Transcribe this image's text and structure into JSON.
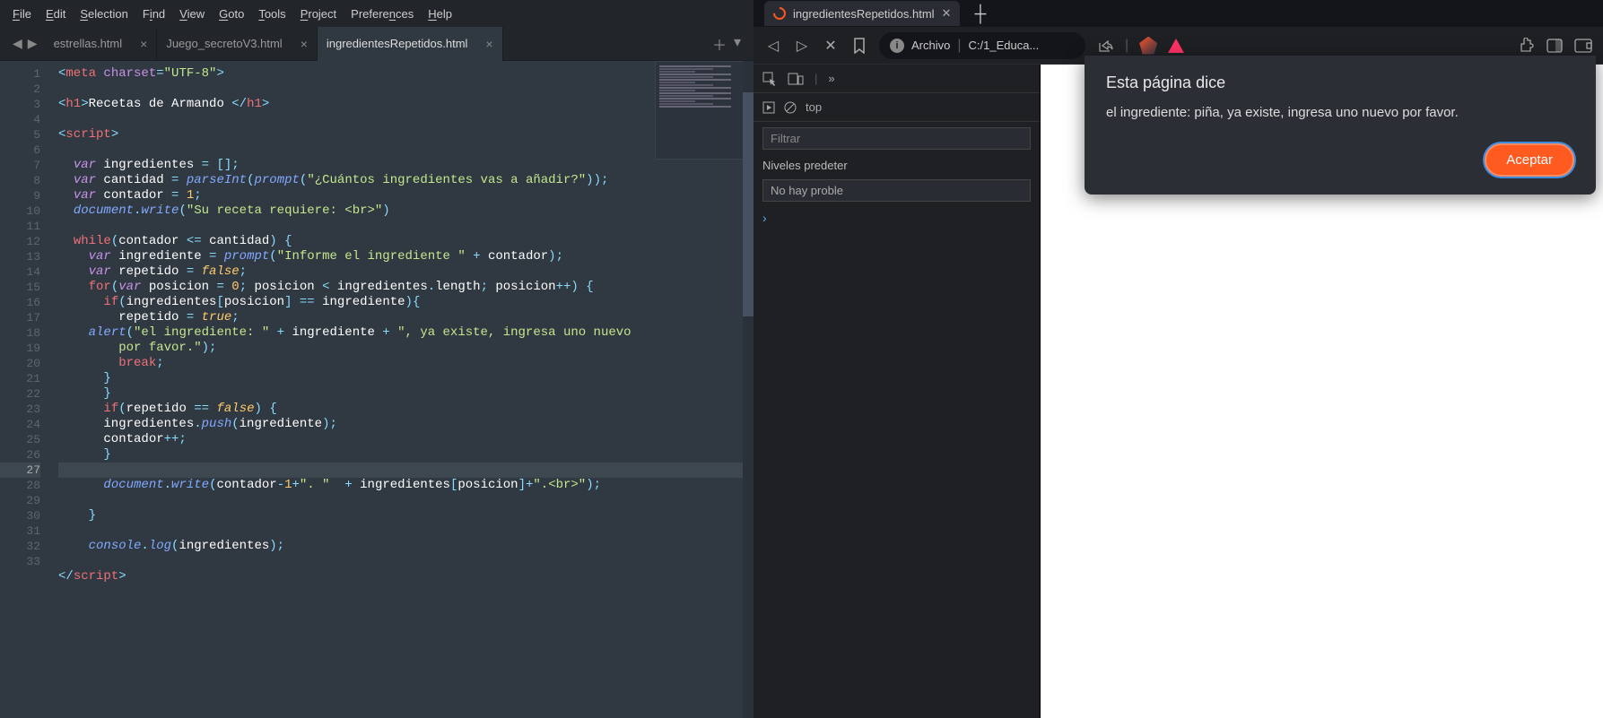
{
  "editor": {
    "menu": [
      "File",
      "Edit",
      "Selection",
      "Find",
      "View",
      "Goto",
      "Tools",
      "Project",
      "Preferences",
      "Help"
    ],
    "nav_prev": "◀",
    "nav_next": "▶",
    "tabs": [
      {
        "label": "estrellas.html",
        "active": false
      },
      {
        "label": "Juego_secretoV3.html",
        "active": false
      },
      {
        "label": "ingredientesRepetidos.html",
        "active": true
      }
    ],
    "line_numbers": [
      "1",
      "2",
      "3",
      "4",
      "5",
      "6",
      "7",
      "8",
      "9",
      "10",
      "11",
      "12",
      "13",
      "14",
      "15",
      "16",
      "17",
      "18",
      "19",
      "20",
      "21",
      "22",
      "23",
      "24",
      "25",
      "26",
      "27",
      "28",
      "29",
      "30",
      "31",
      "32",
      "33"
    ],
    "highlighted_line": 27,
    "code_tokens": [
      [
        [
          "op",
          "<"
        ],
        [
          "tag",
          "meta"
        ],
        [
          "ident",
          " "
        ],
        [
          "attr",
          "charset"
        ],
        [
          "op",
          "="
        ],
        [
          "str",
          "\"UTF-8\""
        ],
        [
          "op",
          ">"
        ]
      ],
      [],
      [
        [
          "op",
          "<"
        ],
        [
          "tag",
          "h1"
        ],
        [
          "op",
          ">"
        ],
        [
          "ident",
          "Recetas de Armando "
        ],
        [
          "op",
          "</"
        ],
        [
          "tag",
          "h1"
        ],
        [
          "op",
          ">"
        ]
      ],
      [],
      [
        [
          "op",
          "<"
        ],
        [
          "tag",
          "script"
        ],
        [
          "op",
          ">"
        ]
      ],
      [],
      [
        [
          "ident",
          "  "
        ],
        [
          "kw",
          "var"
        ],
        [
          "ident",
          " ingredientes "
        ],
        [
          "op",
          "="
        ],
        [
          "ident",
          " "
        ],
        [
          "op",
          "[]"
        ],
        [
          "op",
          ";"
        ]
      ],
      [
        [
          "ident",
          "  "
        ],
        [
          "kw",
          "var"
        ],
        [
          "ident",
          " cantidad "
        ],
        [
          "op",
          "="
        ],
        [
          "ident",
          " "
        ],
        [
          "fn",
          "parseInt"
        ],
        [
          "op",
          "("
        ],
        [
          "fn",
          "prompt"
        ],
        [
          "op",
          "("
        ],
        [
          "str",
          "\"¿Cuántos ingredientes vas a añadir?\""
        ],
        [
          "op",
          "));"
        ]
      ],
      [
        [
          "ident",
          "  "
        ],
        [
          "kw",
          "var"
        ],
        [
          "ident",
          " contador "
        ],
        [
          "op",
          "="
        ],
        [
          "ident",
          " "
        ],
        [
          "num",
          "1"
        ],
        [
          "op",
          ";"
        ]
      ],
      [
        [
          "ident",
          "  "
        ],
        [
          "obj",
          "document"
        ],
        [
          "op",
          "."
        ],
        [
          "fn",
          "write"
        ],
        [
          "op",
          "("
        ],
        [
          "str",
          "\"Su receta requiere: <br>\""
        ],
        [
          "op",
          ")"
        ]
      ],
      [],
      [
        [
          "ident",
          "  "
        ],
        [
          "kw2",
          "while"
        ],
        [
          "op",
          "("
        ],
        [
          "ident",
          "contador "
        ],
        [
          "op",
          "<="
        ],
        [
          "ident",
          " cantidad"
        ],
        [
          "op",
          ")"
        ],
        [
          "ident",
          " "
        ],
        [
          "op",
          "{"
        ]
      ],
      [
        [
          "ident",
          "    "
        ],
        [
          "kw",
          "var"
        ],
        [
          "ident",
          " ingrediente "
        ],
        [
          "op",
          "="
        ],
        [
          "ident",
          " "
        ],
        [
          "fn",
          "prompt"
        ],
        [
          "op",
          "("
        ],
        [
          "str",
          "\"Informe el ingrediente \""
        ],
        [
          "ident",
          " "
        ],
        [
          "op",
          "+"
        ],
        [
          "ident",
          " contador"
        ],
        [
          "op",
          ");"
        ]
      ],
      [
        [
          "ident",
          "    "
        ],
        [
          "kw",
          "var"
        ],
        [
          "ident",
          " repetido "
        ],
        [
          "op",
          "="
        ],
        [
          "ident",
          " "
        ],
        [
          "const",
          "false"
        ],
        [
          "op",
          ";"
        ]
      ],
      [
        [
          "ident",
          "    "
        ],
        [
          "kw2",
          "for"
        ],
        [
          "op",
          "("
        ],
        [
          "kw",
          "var"
        ],
        [
          "ident",
          " posicion "
        ],
        [
          "op",
          "="
        ],
        [
          "ident",
          " "
        ],
        [
          "num",
          "0"
        ],
        [
          "op",
          ";"
        ],
        [
          "ident",
          " posicion "
        ],
        [
          "op",
          "<"
        ],
        [
          "ident",
          " ingredientes"
        ],
        [
          "op",
          "."
        ],
        [
          "ident",
          "length"
        ],
        [
          "op",
          ";"
        ],
        [
          "ident",
          " posicion"
        ],
        [
          "op",
          "++)"
        ],
        [
          "ident",
          " "
        ],
        [
          "op",
          "{"
        ]
      ],
      [
        [
          "ident",
          "      "
        ],
        [
          "kw2",
          "if"
        ],
        [
          "op",
          "("
        ],
        [
          "ident",
          "ingredientes"
        ],
        [
          "op",
          "["
        ],
        [
          "ident",
          "posicion"
        ],
        [
          "op",
          "]"
        ],
        [
          "ident",
          " "
        ],
        [
          "op",
          "=="
        ],
        [
          "ident",
          " ingrediente"
        ],
        [
          "op",
          "){"
        ]
      ],
      [
        [
          "ident",
          "        repetido "
        ],
        [
          "op",
          "="
        ],
        [
          "ident",
          " "
        ],
        [
          "const",
          "true"
        ],
        [
          "op",
          ";"
        ]
      ],
      [
        [
          "ident",
          "    "
        ],
        [
          "fn",
          "alert"
        ],
        [
          "op",
          "("
        ],
        [
          "str",
          "\"el ingrediente: \""
        ],
        [
          "ident",
          " "
        ],
        [
          "op",
          "+"
        ],
        [
          "ident",
          " ingrediente "
        ],
        [
          "op",
          "+"
        ],
        [
          "ident",
          " "
        ],
        [
          "str",
          "\", ya existe, ingresa uno nuevo"
        ]
      ],
      [
        [
          "str",
          "        por favor.\""
        ],
        [
          "op",
          ");"
        ]
      ],
      [
        [
          "ident",
          "        "
        ],
        [
          "kw2",
          "break"
        ],
        [
          "op",
          ";"
        ]
      ],
      [
        [
          "ident",
          "      "
        ],
        [
          "op",
          "}"
        ]
      ],
      [
        [
          "ident",
          "      "
        ],
        [
          "op",
          "}"
        ]
      ],
      [
        [
          "ident",
          "      "
        ],
        [
          "kw2",
          "if"
        ],
        [
          "op",
          "("
        ],
        [
          "ident",
          "repetido "
        ],
        [
          "op",
          "=="
        ],
        [
          "ident",
          " "
        ],
        [
          "const",
          "false"
        ],
        [
          "op",
          ")"
        ],
        [
          "ident",
          " "
        ],
        [
          "op",
          "{"
        ]
      ],
      [
        [
          "ident",
          "      ingredientes"
        ],
        [
          "op",
          "."
        ],
        [
          "fn",
          "push"
        ],
        [
          "op",
          "("
        ],
        [
          "ident",
          "ingrediente"
        ],
        [
          "op",
          ");"
        ]
      ],
      [
        [
          "ident",
          "      contador"
        ],
        [
          "op",
          "++;"
        ]
      ],
      [
        [
          "ident",
          "      "
        ],
        [
          "op",
          "}"
        ]
      ],
      [],
      [
        [
          "ident",
          "      "
        ],
        [
          "obj",
          "document"
        ],
        [
          "op",
          "."
        ],
        [
          "fn",
          "write"
        ],
        [
          "op",
          "("
        ],
        [
          "ident",
          "contador"
        ],
        [
          "op",
          "-"
        ],
        [
          "num",
          "1"
        ],
        [
          "op",
          "+"
        ],
        [
          "str",
          "\". \""
        ],
        [
          "ident",
          "  "
        ],
        [
          "op",
          "+"
        ],
        [
          "ident",
          " ingredientes"
        ],
        [
          "op",
          "["
        ],
        [
          "ident",
          "posicion"
        ],
        [
          "op",
          "]+"
        ],
        [
          "str",
          "\".<br>\""
        ],
        [
          "op",
          ");"
        ]
      ],
      [],
      [
        [
          "ident",
          "    "
        ],
        [
          "op",
          "}"
        ]
      ],
      [],
      [
        [
          "ident",
          "    "
        ],
        [
          "obj",
          "console"
        ],
        [
          "op",
          "."
        ],
        [
          "fn",
          "log"
        ],
        [
          "op",
          "("
        ],
        [
          "ident",
          "ingredientes"
        ],
        [
          "op",
          ");"
        ]
      ],
      [],
      [
        [
          "op",
          "</"
        ],
        [
          "tag",
          "script"
        ],
        [
          "op",
          ">"
        ]
      ]
    ]
  },
  "browser": {
    "tab_title": "ingredientesRepetidos.html",
    "toolbar": {
      "back_icon": "◁",
      "forward_icon": "▷",
      "close_icon": "✕",
      "bookmark_icon": "🔖",
      "addr_label": "Archivo",
      "addr_path": "C:/1_Educa...",
      "share_icon": "⤴"
    },
    "devtools": {
      "top_label": "top",
      "filter_placeholder": "Filtrar",
      "levels_label": "Niveles predeter",
      "problems_label": "No hay proble",
      "prompt": "›"
    },
    "dialog": {
      "title": "Esta página dice",
      "message": "el ingrediente: piña, ya existe, ingresa uno nuevo por favor.",
      "accept": "Aceptar"
    }
  }
}
